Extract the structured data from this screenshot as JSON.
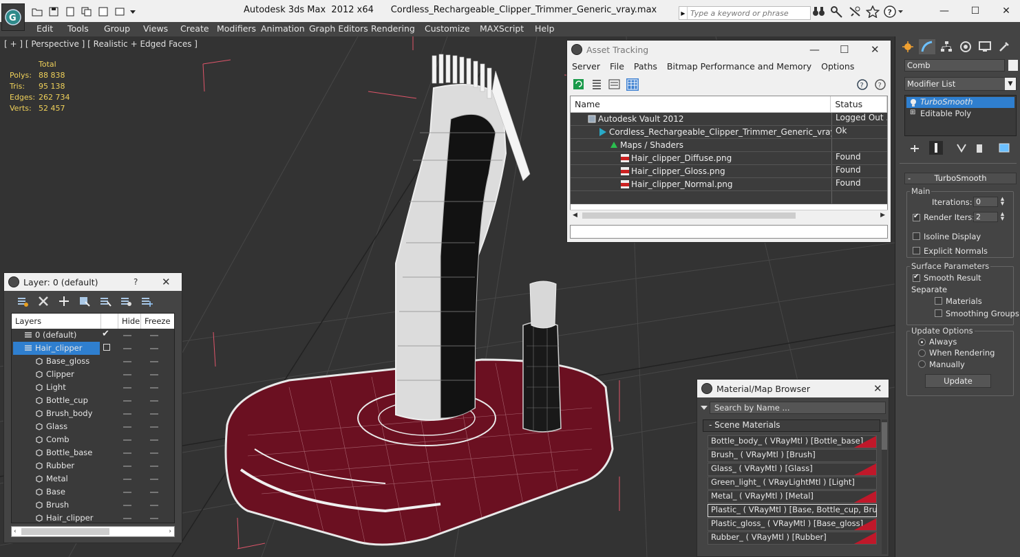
{
  "titlebar": {
    "app": "Autodesk 3ds Max  2012 x64",
    "file": "Cordless_Rechargeable_Clipper_Trimmer_Generic_vray.max",
    "search_placeholder": "Type a keyword or phrase"
  },
  "menu": [
    "Edit",
    "Tools",
    "Group",
    "Views",
    "Create",
    "Modifiers",
    "Animation",
    "Graph Editors",
    "Rendering",
    "Customize",
    "MAXScript",
    "Help"
  ],
  "viewport": {
    "label": "[ + ] [ Perspective ] [ Realistic + Edged Faces ]",
    "stats": {
      "header": "Total",
      "rows": [
        {
          "k": "Polys:",
          "v": "88 838"
        },
        {
          "k": "Tris:",
          "v": "95 138"
        },
        {
          "k": "Edges:",
          "v": "262 734"
        },
        {
          "k": "Verts:",
          "v": "52 457"
        }
      ]
    }
  },
  "asset_tracking": {
    "title": "Asset Tracking",
    "menu": [
      "Server",
      "File",
      "Paths",
      "Bitmap Performance and Memory",
      "Options"
    ],
    "col_name": "Name",
    "col_status": "Status",
    "rows": [
      {
        "name": "Autodesk Vault 2012",
        "status": "Logged Out ...",
        "icon": "vault-icon"
      },
      {
        "name": "Cordless_Rechargeable_Clipper_Trimmer_Generic_vray.max",
        "status": "Ok",
        "icon": "max-file-icon"
      },
      {
        "name": "Maps / Shaders",
        "status": "",
        "icon": "maps-icon"
      },
      {
        "name": "Hair_clipper_Diffuse.png",
        "status": "Found",
        "icon": "png-icon"
      },
      {
        "name": "Hair_clipper_Gloss.png",
        "status": "Found",
        "icon": "png-icon"
      },
      {
        "name": "Hair_clipper_Normal.png",
        "status": "Found",
        "icon": "png-icon"
      }
    ]
  },
  "layer_panel": {
    "title": "Layer: 0 (default)",
    "help": "?",
    "col_layers": "Layers",
    "col_hide": "Hide",
    "col_freeze": "Freeze",
    "layers": [
      {
        "name": "0 (default)",
        "level": 1
      },
      {
        "name": "Hair_clipper",
        "level": 1
      },
      {
        "name": "Base_gloss",
        "level": 2
      },
      {
        "name": "Clipper",
        "level": 2
      },
      {
        "name": "Light",
        "level": 2
      },
      {
        "name": "Bottle_cup",
        "level": 2
      },
      {
        "name": "Brush_body",
        "level": 2
      },
      {
        "name": "Glass",
        "level": 2
      },
      {
        "name": "Comb",
        "level": 2
      },
      {
        "name": "Bottle_base",
        "level": 2
      },
      {
        "name": "Rubber",
        "level": 2
      },
      {
        "name": "Metal",
        "level": 2
      },
      {
        "name": "Base",
        "level": 2
      },
      {
        "name": "Brush",
        "level": 2
      },
      {
        "name": "Hair_clipper",
        "level": 2
      }
    ]
  },
  "material_browser": {
    "title": "Material/Map Browser",
    "search_placeholder": "Search by Name ...",
    "section": "- Scene Materials",
    "materials": [
      {
        "label": "Bottle_body_  ( VRayMtl ) [Bottle_base]",
        "swatch": true
      },
      {
        "label": "Brush_  ( VRayMtl ) [Brush]",
        "swatch": false
      },
      {
        "label": "Glass_  ( VRayMtl ) [Glass]",
        "swatch": true
      },
      {
        "label": "Green_light_  ( VRayLightMtl ) [Light]",
        "swatch": false
      },
      {
        "label": "Metal_  ( VRayMtl ) [Metal]",
        "swatch": true
      },
      {
        "label": "Plastic_  ( VRayMtl ) [Base, Bottle_cup, Brus...",
        "swatch": false
      },
      {
        "label": "Plastic_gloss_  ( VRayMtl ) [Base_gloss]",
        "swatch": true
      },
      {
        "label": "Rubber_  ( VRayMtl ) [Rubber]",
        "swatch": true
      }
    ]
  },
  "command_panel": {
    "object_name": "Comb",
    "modifier_list": "Modifier List",
    "stack": [
      "TurboSmooth",
      "Editable Poly"
    ],
    "rollout_title": "TurboSmooth",
    "main_group": "Main",
    "iterations_label": "Iterations:",
    "iterations_value": "0",
    "render_iters_label": "Render Iters:",
    "render_iters_value": "2",
    "isoline": "Isoline Display",
    "explicit_normals": "Explicit Normals",
    "surface_group": "Surface Parameters",
    "smooth_result": "Smooth Result",
    "separate_label": "Separate",
    "materials": "Materials",
    "smoothing_groups": "Smoothing Groups",
    "update_group": "Update Options",
    "always": "Always",
    "when_rendering": "When Rendering",
    "manually": "Manually",
    "update_btn": "Update"
  },
  "colors": {
    "selection": "#2f7fcf",
    "stats": "#f0d15a",
    "material_swatch": "#c0182a",
    "base_mesh": "#6b1021"
  }
}
